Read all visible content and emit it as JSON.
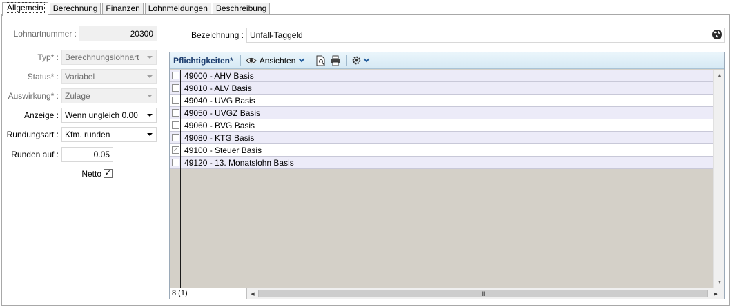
{
  "tabs": [
    {
      "label": "Allgemein",
      "active": true
    },
    {
      "label": "Berechnung"
    },
    {
      "label": "Finanzen"
    },
    {
      "label": "Lohnmeldungen"
    },
    {
      "label": "Beschreibung"
    }
  ],
  "form": {
    "lohnartnummer": {
      "label": "Lohnartnummer :",
      "value": "20300"
    },
    "typ": {
      "label": "Typ* :",
      "value": "Berechnungslohnart"
    },
    "status": {
      "label": "Status* :",
      "value": "Variabel"
    },
    "auswirkung": {
      "label": "Auswirkung* :",
      "value": "Zulage"
    },
    "anzeige": {
      "label": "Anzeige :",
      "value": "Wenn ungleich 0.00"
    },
    "rundungsart": {
      "label": "Rundungsart :",
      "value": "Kfm. runden"
    },
    "runden_auf": {
      "label": "Runden auf :",
      "value": "0.05"
    },
    "netto": {
      "label": "Netto",
      "checked": true
    },
    "bezeichnung": {
      "label": "Bezeichnung :",
      "value": "Unfall-Taggeld"
    }
  },
  "grid": {
    "title": "Pflichtigkeiten*",
    "views_label": "Ansichten",
    "rows": [
      {
        "label": "49000 - AHV Basis",
        "checked": false
      },
      {
        "label": "49010 - ALV Basis",
        "checked": false
      },
      {
        "label": "49040 - UVG Basis",
        "checked": false
      },
      {
        "label": "49050 - UVGZ Basis",
        "checked": false
      },
      {
        "label": "49060 - BVG Basis",
        "checked": false
      },
      {
        "label": "49080 - KTG Basis",
        "checked": false
      },
      {
        "label": "49100 - Steuer Basis",
        "checked": true
      },
      {
        "label": "49120 - 13. Monatslohn Basis",
        "checked": false
      }
    ],
    "footer_count": "8 (1)"
  },
  "icons": [
    "globe-icon",
    "eye-icon",
    "print-preview-icon",
    "printer-icon",
    "gear-icon"
  ]
}
